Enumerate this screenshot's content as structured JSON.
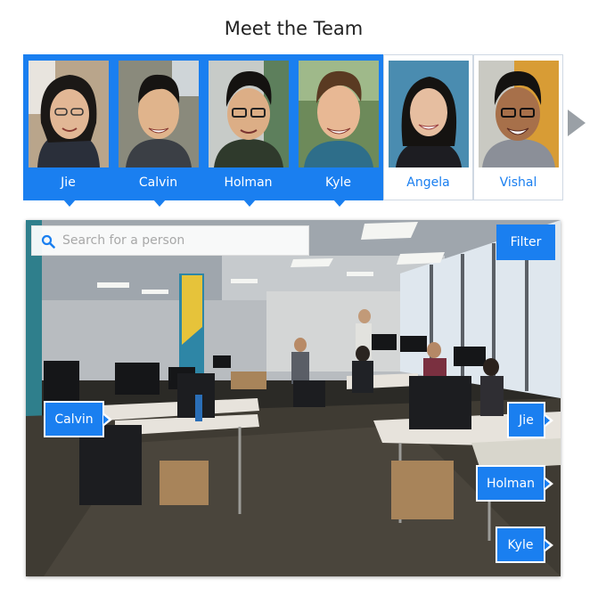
{
  "header": {
    "title": "Meet the Team"
  },
  "people": [
    {
      "name": "Jie",
      "selected": true
    },
    {
      "name": "Calvin",
      "selected": true
    },
    {
      "name": "Holman",
      "selected": true
    },
    {
      "name": "Kyle",
      "selected": true
    },
    {
      "name": "Angela",
      "selected": false
    },
    {
      "name": "Vishal",
      "selected": false
    }
  ],
  "search": {
    "placeholder": "Search for a person",
    "value": ""
  },
  "filter": {
    "label": "Filter"
  },
  "tags": {
    "calvin": "Calvin",
    "jie": "Jie",
    "holman": "Holman",
    "kyle": "Kyle"
  },
  "colors": {
    "accent": "#1a7ff0",
    "border": "#cfd8e3",
    "arrow": "#9aa0a6"
  },
  "icons": {
    "search": "search-icon",
    "next": "chevron-right-icon"
  }
}
